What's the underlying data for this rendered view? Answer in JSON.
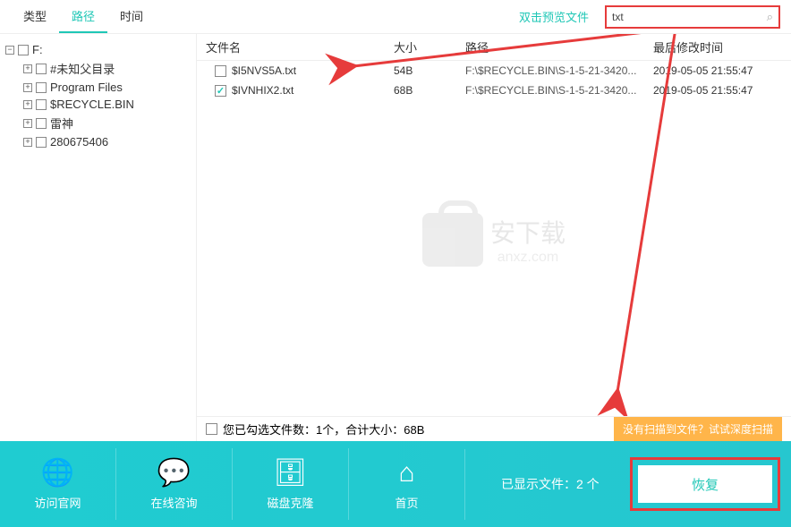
{
  "tabs": {
    "type": "类型",
    "path": "路径",
    "time": "时间"
  },
  "preview_hint": "双击预览文件",
  "search": {
    "value": "txt"
  },
  "tree": {
    "root": "F:",
    "items": [
      {
        "label": "#未知父目录"
      },
      {
        "label": "Program Files"
      },
      {
        "label": "$RECYCLE.BIN"
      },
      {
        "label": "雷神"
      },
      {
        "label": "280675406"
      }
    ]
  },
  "columns": {
    "name": "文件名",
    "size": "大小",
    "path": "路径",
    "time": "最后修改时间"
  },
  "rows": [
    {
      "checked": false,
      "name": "$I5NVS5A.txt",
      "size": "54B",
      "path": "F:\\$RECYCLE.BIN\\S-1-5-21-3420...",
      "time": "2019-05-05 21:55:47"
    },
    {
      "checked": true,
      "name": "$IVNHIX2.txt",
      "size": "68B",
      "path": "F:\\$RECYCLE.BIN\\S-1-5-21-3420...",
      "time": "2019-05-05 21:55:47"
    }
  ],
  "watermark": {
    "title": "安下载",
    "sub": "anxz.com"
  },
  "summary": "您已勾选文件数：1个，合计大小：68B",
  "deep_scan": "没有扫描到文件？试试深度扫描",
  "bottom": {
    "website": "访问官网",
    "chat": "在线咨询",
    "clone": "磁盘克隆",
    "home": "首页",
    "displayed": "已显示文件：2 个",
    "recover": "恢复"
  }
}
